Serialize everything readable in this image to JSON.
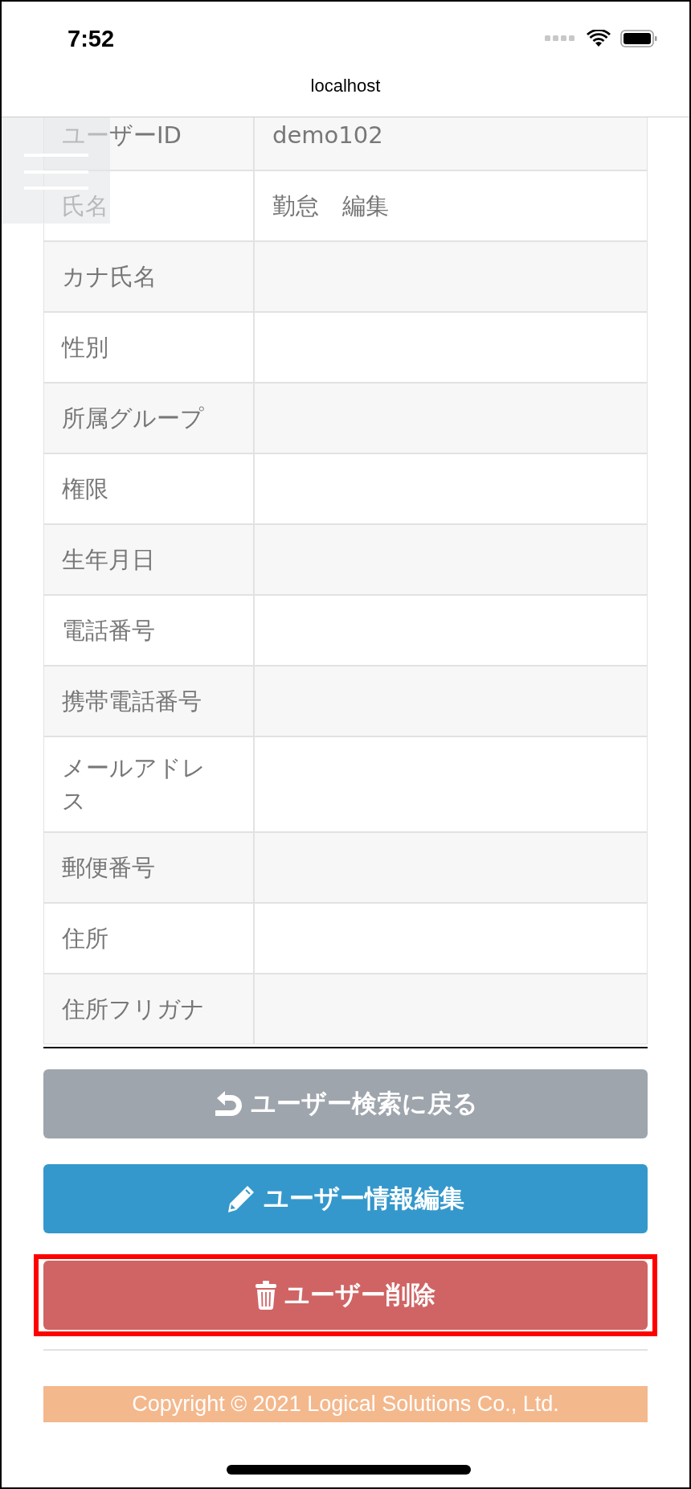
{
  "status_bar": {
    "time": "7:52"
  },
  "address_bar": {
    "url": "localhost"
  },
  "table": {
    "rows": [
      {
        "label": "ユーザーID",
        "value": "demo102"
      },
      {
        "label": "氏名",
        "value": "勤怠　編集"
      },
      {
        "label": "カナ氏名"
      },
      {
        "label": "性別"
      },
      {
        "label": "所属グループ"
      },
      {
        "label": "権限"
      },
      {
        "label": "生年月日"
      },
      {
        "label": "電話番号"
      },
      {
        "label": "携帯電話番号"
      },
      {
        "label": "メールアドレス"
      },
      {
        "label": "郵便番号"
      },
      {
        "label": "住所"
      },
      {
        "label": "住所フリガナ"
      }
    ]
  },
  "buttons": [
    {
      "label": "ユーザー検索に戻る",
      "kind": "back",
      "highlighted": false
    },
    {
      "label": "ユーザー情報編集",
      "kind": "edit",
      "highlighted": false
    },
    {
      "label": "ユーザー削除",
      "kind": "delete",
      "highlighted": true
    }
  ],
  "footer": {
    "copyright": "Copyright © 2021 Logical Solutions Co., Ltd."
  }
}
